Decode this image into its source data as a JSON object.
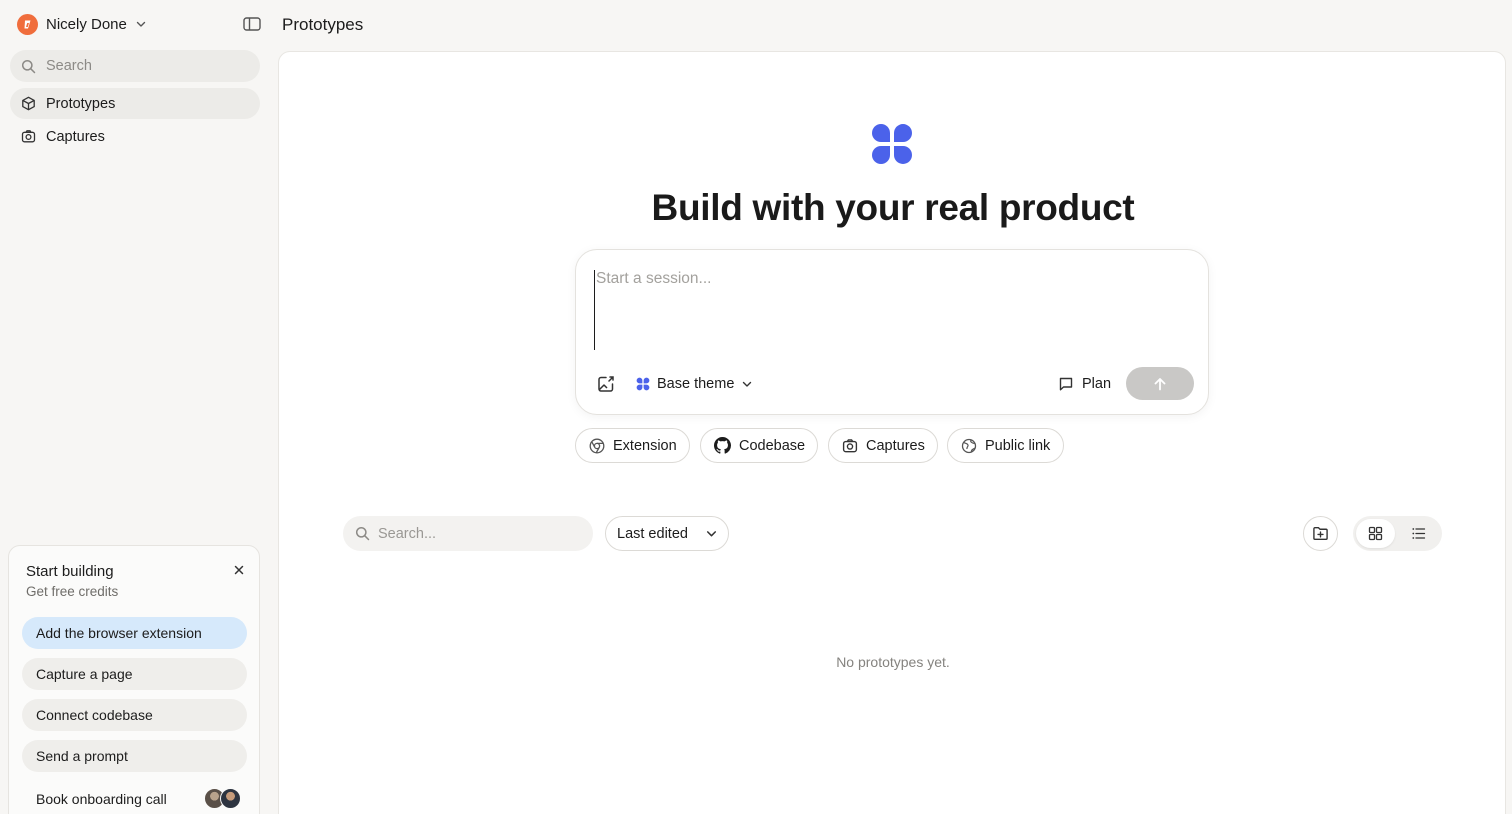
{
  "workspace": {
    "name": "Nicely Done"
  },
  "sidebar": {
    "search_placeholder": "Search",
    "items": [
      {
        "label": "Prototypes",
        "icon": "cube-icon",
        "active": true
      },
      {
        "label": "Captures",
        "icon": "camera-icon",
        "active": false
      }
    ]
  },
  "onboarding": {
    "title": "Start building",
    "subtitle": "Get free credits",
    "tasks": [
      {
        "label": "Add the browser extension"
      },
      {
        "label": "Capture a page"
      },
      {
        "label": "Connect codebase"
      },
      {
        "label": "Send a prompt"
      },
      {
        "label": "Book onboarding call"
      }
    ]
  },
  "header": {
    "title": "Prototypes"
  },
  "main": {
    "hero_title": "Build with your real product",
    "composer": {
      "placeholder": "Start a session...",
      "theme_label": "Base theme",
      "plan_label": "Plan"
    },
    "chips": [
      {
        "label": "Extension",
        "icon": "chrome-icon"
      },
      {
        "label": "Codebase",
        "icon": "github-icon"
      },
      {
        "label": "Captures",
        "icon": "camera-icon"
      },
      {
        "label": "Public link",
        "icon": "globe-link-icon"
      }
    ],
    "list": {
      "search_placeholder": "Search...",
      "sort_label": "Last edited",
      "empty_text": "No prototypes yet."
    }
  },
  "colors": {
    "brand_blue": "#4b62ea",
    "workspace_orange": "#f06d3c",
    "highlight_blue": "#d6e9fb"
  }
}
